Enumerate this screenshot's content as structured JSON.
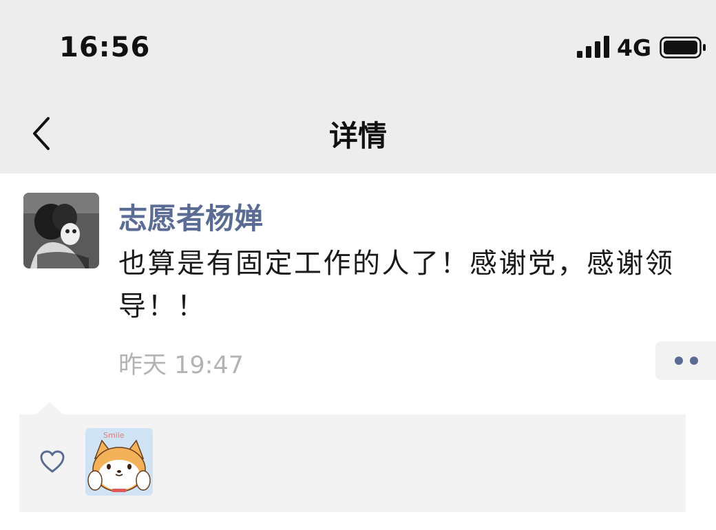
{
  "status_bar": {
    "time": "16:56",
    "network": "4G",
    "signal_icon": "signal-bars-icon",
    "battery_icon": "battery-icon"
  },
  "nav": {
    "back_icon": "chevron-left-icon",
    "title": "详情"
  },
  "post": {
    "author": "志愿者杨婵",
    "text": "也算是有固定工作的人了！感谢党，感谢领导！！",
    "time": "昨天 19:47",
    "more_icon": "more-dots-icon"
  },
  "likes": {
    "heart_icon": "heart-outline-icon",
    "liker_avatar_text": "Smile"
  },
  "colors": {
    "header_bg": "#ededed",
    "name_color": "#5a6b94",
    "time_color": "#b3b3b3",
    "panel_bg": "#f3f3f3"
  }
}
